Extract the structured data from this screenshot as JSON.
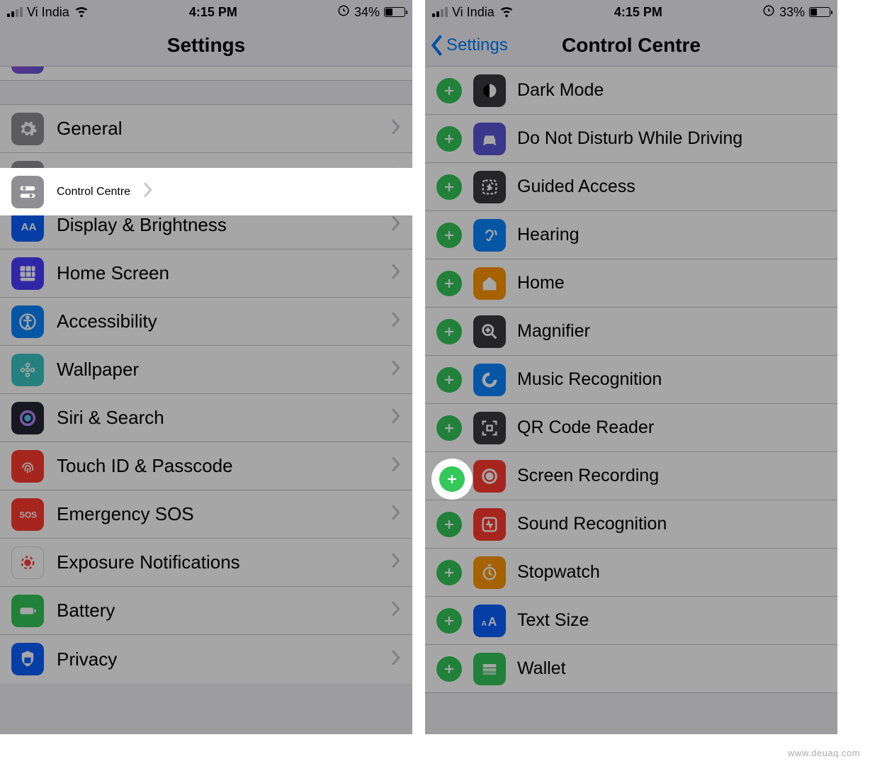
{
  "watermark": "www.deuaq.com",
  "left": {
    "status": {
      "carrier": "Vi India",
      "time": "4:15 PM",
      "battery": "34%"
    },
    "title": "Settings",
    "items": [
      {
        "name": "general",
        "label": "General",
        "color": "#8e8e93"
      },
      {
        "name": "control-centre",
        "label": "Control Centre",
        "color": "#8e8e93",
        "highlighted": true
      },
      {
        "name": "display-brightness",
        "label": "Display & Brightness",
        "color": "#0a60ff"
      },
      {
        "name": "home-screen",
        "label": "Home Screen",
        "color": "#4a3cff"
      },
      {
        "name": "accessibility",
        "label": "Accessibility",
        "color": "#0a84ff"
      },
      {
        "name": "wallpaper",
        "label": "Wallpaper",
        "color": "#38c7c4"
      },
      {
        "name": "siri-search",
        "label": "Siri & Search",
        "color": "#262533"
      },
      {
        "name": "touch-id",
        "label": "Touch ID & Passcode",
        "color": "#ff3b30"
      },
      {
        "name": "emergency-sos",
        "label": "Emergency SOS",
        "color": "#ff3b30"
      },
      {
        "name": "exposure",
        "label": "Exposure Notifications",
        "color": "#ffffff"
      },
      {
        "name": "battery",
        "label": "Battery",
        "color": "#34c759"
      },
      {
        "name": "privacy",
        "label": "Privacy",
        "color": "#0a60ff"
      }
    ]
  },
  "right": {
    "status": {
      "carrier": "Vi India",
      "time": "4:15 PM",
      "battery": "33%"
    },
    "back": "Settings",
    "title": "Control Centre",
    "items": [
      {
        "name": "dark-mode",
        "label": "Dark Mode",
        "color": "#3a3a3c"
      },
      {
        "name": "dnd-driving",
        "label": "Do Not Disturb While Driving",
        "color": "#5856d6"
      },
      {
        "name": "guided-access",
        "label": "Guided Access",
        "color": "#3a3a3c"
      },
      {
        "name": "hearing",
        "label": "Hearing",
        "color": "#0a84ff"
      },
      {
        "name": "home",
        "label": "Home",
        "color": "#ff9500"
      },
      {
        "name": "magnifier",
        "label": "Magnifier",
        "color": "#3a3a3c"
      },
      {
        "name": "music-recognition",
        "label": "Music Recognition",
        "color": "#0a84ff"
      },
      {
        "name": "qr-code",
        "label": "QR Code Reader",
        "color": "#3a3a3c"
      },
      {
        "name": "screen-recording",
        "label": "Screen Recording",
        "color": "#ff3b30",
        "highlighted": true
      },
      {
        "name": "sound-recognition",
        "label": "Sound Recognition",
        "color": "#ff3b30"
      },
      {
        "name": "stopwatch",
        "label": "Stopwatch",
        "color": "#ff9500"
      },
      {
        "name": "text-size",
        "label": "Text Size",
        "color": "#0a60ff"
      },
      {
        "name": "wallet",
        "label": "Wallet",
        "color": "#34c759"
      }
    ]
  }
}
